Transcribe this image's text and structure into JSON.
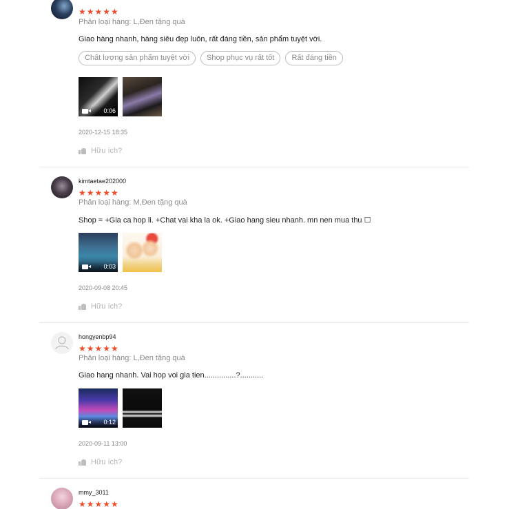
{
  "reviews": [
    {
      "username": "",
      "stars": "★★★★★",
      "variant": "Phân loại hàng: L,Đen tặng quà",
      "comment": "Giao hàng nhanh, hàng siêu đẹp luôn, rất đáng tiền, sản phẩm tuyệt vời.",
      "tags": [
        "Chất lượng sản phẩm tuyệt vời",
        "Shop phục vụ rất tốt",
        "Rất đáng tiền"
      ],
      "video_duration": "0:06",
      "date": "2020-12-15 18:35",
      "helpful": "Hữu ích?"
    },
    {
      "username": "kimtaetae202000",
      "stars": "★★★★★",
      "variant": "Phân loại hàng: M,Đen tặng quà",
      "comment": "Shop = +Gia ca hop li. +Chat vai kha la ok. +Giao hang sieu nhanh. mn nen mua thu ☐",
      "tags": [],
      "video_duration": "0:03",
      "date": "2020-09-08 20:45",
      "helpful": "Hữu ích?"
    },
    {
      "username": "hongyenbp94",
      "stars": "★★★★★",
      "variant": "Phân loại hàng: L,Đen tặng quà",
      "comment": "Giao hang nhanh.  Vai hop voi gia tien...............?...........",
      "tags": [],
      "video_duration": "0:12",
      "date": "2020-09-11 13:00",
      "helpful": "Hữu ích?"
    },
    {
      "username": "mmy_3011",
      "stars": "★★★★★"
    }
  ],
  "colors": {
    "accent": "#ee4d2d",
    "muted": "#8a8a8a"
  }
}
